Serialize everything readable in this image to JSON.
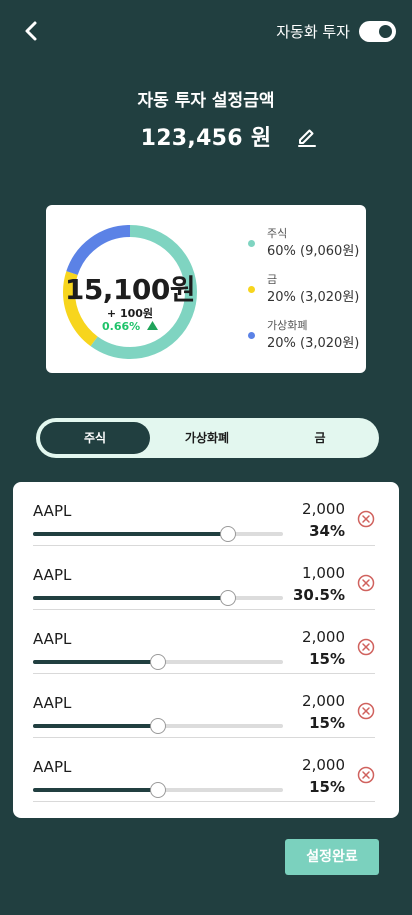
{
  "header": {
    "auto_invest_label": "자동화 투자",
    "auto_invest_enabled": true
  },
  "setting": {
    "title": "자동 투자 설정금액",
    "amount": "123,456 원"
  },
  "summary": {
    "total": "15,100원",
    "delta_amount": "+ 100원",
    "delta_pct": "0.66%",
    "delta_icon": "triangle-up-icon",
    "legend": [
      {
        "name": "주식",
        "value": "60% (9,060원)",
        "color": "#7fd4c1",
        "share": 60
      },
      {
        "name": "금",
        "value": "20% (3,020원)",
        "color": "#f7d51d",
        "share": 20
      },
      {
        "name": "가상화폐",
        "value": "20% (3,020원)",
        "color": "#5b82e6",
        "share": 20
      }
    ]
  },
  "tabs": [
    {
      "label": "주식",
      "active": true
    },
    {
      "label": "가상화폐",
      "active": false
    },
    {
      "label": "금",
      "active": false
    }
  ],
  "assets": [
    {
      "name": "AAPL",
      "amount": "2,000",
      "percent": "34%",
      "level": 0.78
    },
    {
      "name": "AAPL",
      "amount": "1,000",
      "percent": "30.5%",
      "level": 0.78
    },
    {
      "name": "AAPL",
      "amount": "2,000",
      "percent": "15%",
      "level": 0.5
    },
    {
      "name": "AAPL",
      "amount": "2,000",
      "percent": "15%",
      "level": 0.5
    },
    {
      "name": "AAPL",
      "amount": "2,000",
      "percent": "15%",
      "level": 0.5
    }
  ],
  "complete_button": "설정완료"
}
